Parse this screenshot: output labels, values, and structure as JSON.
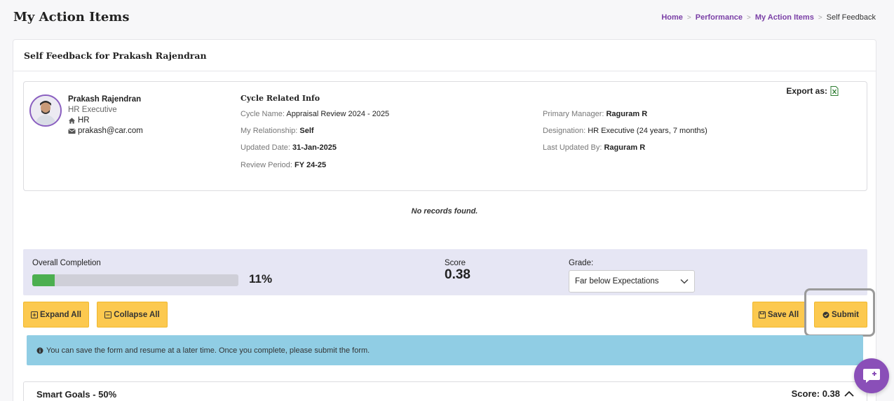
{
  "page": {
    "title": "My Action Items",
    "breadcrumb": [
      "Home",
      "Performance",
      "My Action Items",
      "Self Feedback"
    ]
  },
  "card": {
    "header": "Self Feedback for Prakash Rajendran"
  },
  "profile": {
    "name": "Prakash Rajendran",
    "role": "HR Executive",
    "department": "HR",
    "email": "prakash@car.com"
  },
  "cycle": {
    "heading": "Cycle Related Info",
    "cycle_name_label": "Cycle Name:",
    "cycle_name": "Appraisal Review 2024 - 2025",
    "relationship_label": "My Relationship:",
    "relationship": "Self",
    "updated_date_label": "Updated Date:",
    "updated_date": "31-Jan-2025",
    "review_period_label": "Review Period:",
    "review_period": "FY 24-25",
    "primary_manager_label": "Primary Manager:",
    "primary_manager": "Raguram R",
    "designation_label": "Designation:",
    "designation": "HR Executive (24 years, 7 months)",
    "last_updated_by_label": "Last Updated By:",
    "last_updated_by": "Raguram R",
    "export_label": "Export as:"
  },
  "no_records": "No records found.",
  "completion": {
    "label": "Overall Completion",
    "percent_text": "11%",
    "percent": 11,
    "score_label": "Score",
    "score": "0.38",
    "grade_label": "Grade:",
    "grade_selected": "Far below Expectations"
  },
  "actions": {
    "expand_all": "Expand All",
    "collapse_all": "Collapse All",
    "save_all": "Save All",
    "submit": "Submit"
  },
  "alert": {
    "text": "You can save the form and resume at a later time. Once you complete, please submit the form."
  },
  "section": {
    "title": "Smart Goals - 50%",
    "score": "Score: 0.38"
  },
  "colors": {
    "accent": "#7a3fa6",
    "button": "#fcc94f",
    "progress": "#4caf50",
    "alert": "#90cde4"
  }
}
